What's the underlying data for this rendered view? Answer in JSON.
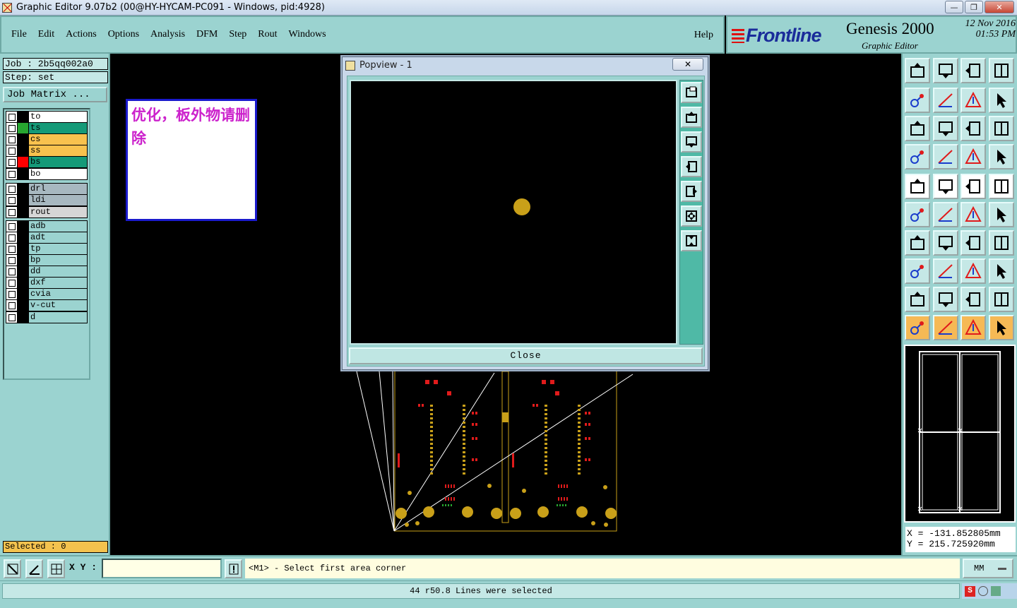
{
  "window": {
    "title": "Graphic Editor 9.07b2 (00@HY-HYCAM-PC091 - Windows, pid:4928)"
  },
  "menu": [
    {
      "id": "file",
      "label": "File"
    },
    {
      "id": "edit",
      "label": "Edit"
    },
    {
      "id": "actions",
      "label": "Actions"
    },
    {
      "id": "options",
      "label": "Options"
    },
    {
      "id": "analysis",
      "label": "Analysis"
    },
    {
      "id": "dfm",
      "label": "DFM"
    },
    {
      "id": "step",
      "label": "Step"
    },
    {
      "id": "rout",
      "label": "Rout"
    },
    {
      "id": "windows",
      "label": "Windows"
    }
  ],
  "help_label": "Help",
  "logo": {
    "brand": "Frontline",
    "product": "Genesis 2000",
    "sub": "Graphic Editor",
    "date": "12 Nov 2016",
    "time": "01:53 PM"
  },
  "job": {
    "job_label": "Job : 2b5qq002a0",
    "step_label": "Step: set",
    "matrix_button": "Job Matrix ..."
  },
  "layer_groups": [
    [
      {
        "name": "to",
        "bg": "#ffffff",
        "col": "#000000"
      },
      {
        "name": "ts",
        "bg": "#159a78",
        "col": "#27a630"
      },
      {
        "name": "cs",
        "bg": "#f8c24e",
        "col": "#000000"
      },
      {
        "name": "ss",
        "bg": "#f8c24e",
        "col": "#000000"
      },
      {
        "name": "bs",
        "bg": "#159a78",
        "col": "#ff0000"
      },
      {
        "name": "bo",
        "bg": "#ffffff",
        "col": "#000000"
      }
    ],
    [
      {
        "name": "drl",
        "bg": "#a7b8c0",
        "col": "#000000"
      },
      {
        "name": "ldi",
        "bg": "#a7b8c0",
        "col": "#000000"
      },
      {
        "name": "rout",
        "bg": "#d6d6d6",
        "col": "#000000"
      }
    ],
    [
      {
        "name": "adb",
        "bg": "#9bd3d0",
        "col": "#000000"
      },
      {
        "name": "adt",
        "bg": "#9bd3d0",
        "col": "#000000"
      },
      {
        "name": "tp",
        "bg": "#9bd3d0",
        "col": "#000000"
      },
      {
        "name": "bp",
        "bg": "#9bd3d0",
        "col": "#000000"
      },
      {
        "name": "dd",
        "bg": "#9bd3d0",
        "col": "#000000"
      },
      {
        "name": "dxf",
        "bg": "#9bd3d0",
        "col": "#000000"
      },
      {
        "name": "cvia",
        "bg": "#9bd3d0",
        "col": "#000000"
      },
      {
        "name": "v-cut",
        "bg": "#9bd3d0",
        "col": "#000000"
      },
      {
        "name": "d",
        "bg": "#9bd3d0",
        "col": "#000000"
      }
    ]
  ],
  "selected_label": "Selected : 0",
  "note": {
    "text": "优化，板外物请删除"
  },
  "popview": {
    "title": "Popview - 1",
    "close_label": "Close"
  },
  "coords": {
    "x": "X = -131.852805mm",
    "y": "Y = 215.725920mm"
  },
  "bottom": {
    "xy_label": "X Y :",
    "xy_value": "",
    "prompt": "<M1> - Select first area corner",
    "units": "MM"
  },
  "status": {
    "message": "44 r50.8 Lines were selected"
  },
  "colors": {
    "panel": "#9bd3d0",
    "accent_gold": "#c9a019",
    "pad_red": "#e01b1b"
  }
}
